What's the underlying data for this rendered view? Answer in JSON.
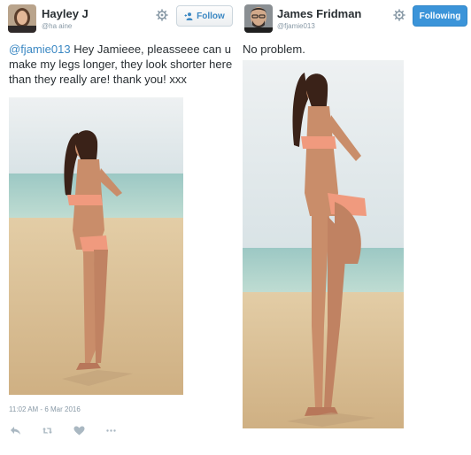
{
  "left_tweet": {
    "user_name": "Hayley J",
    "user_handle": "@ha          aine",
    "follow_label": "Follow",
    "mention": "@fjamie013",
    "text": " Hey Jamieee, pleasseee can u make my legs longer, they look shorter here than they really are! thank you! xxx",
    "timestamp": "11:02 AM - 6 Mar 2016",
    "actions": [
      "reply-icon",
      "retweet-icon",
      "like-icon",
      "more-icon"
    ]
  },
  "right_tweet": {
    "user_name": "James Fridman",
    "user_handle": "@fjamie013",
    "following_label": "Following",
    "text": "No problem."
  },
  "colors": {
    "link": "#3b88c3",
    "following_bg": "#3b94d9",
    "meta_gray": "#8899a6",
    "text": "#292f33"
  }
}
